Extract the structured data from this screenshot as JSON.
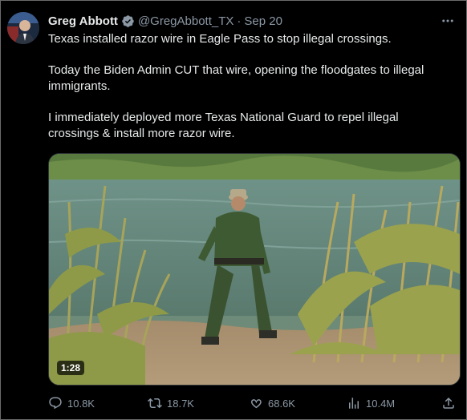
{
  "author": {
    "name": "Greg Abbott",
    "handle": "@GregAbbott_TX",
    "separator": "·",
    "date": "Sep 20"
  },
  "tweet": {
    "paragraphs": [
      "Texas installed razor wire in Eagle Pass to stop illegal crossings.",
      "Today the Biden Admin CUT that wire, opening the floodgates to illegal immigrants.",
      "I immediately deployed more Texas National Guard to repel illegal crossings & install more razor wire."
    ]
  },
  "media": {
    "duration": "1:28"
  },
  "actions": {
    "replies": "10.8K",
    "reposts": "18.7K",
    "likes": "68.6K",
    "views": "10.4M"
  },
  "colors": {
    "background": "#000000",
    "text": "#e7e9ea",
    "muted": "#8b98a5",
    "verified": "#1d9bf0"
  },
  "icons": [
    "verified-badge-icon",
    "more-icon",
    "reply-icon",
    "repost-icon",
    "like-icon",
    "views-icon",
    "share-icon"
  ]
}
